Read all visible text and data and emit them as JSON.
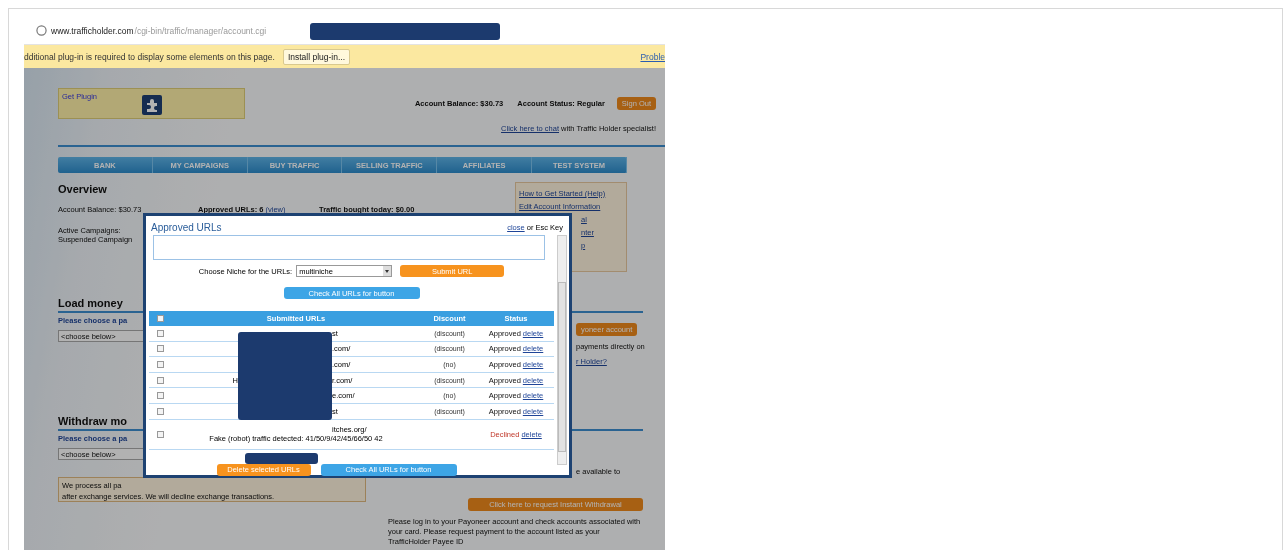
{
  "browser": {
    "url_host": "www.trafficholder.com",
    "url_path": "/cgi-bin/traffic/manager/account.cgi"
  },
  "plugin_bar": {
    "message": "dditional plug-in is required to display some elements on this page.",
    "button": "Install plug-in...",
    "link": "Proble"
  },
  "header": {
    "plugin_label": "Get Plugin",
    "balance": "Account Balance: $30.73",
    "status": "Account Status: Regular",
    "sign_out": "Sign Out",
    "chat_link": "Click here to chat",
    "chat_text": "with Traffic Holder specialist!"
  },
  "nav": [
    {
      "label": "BANK"
    },
    {
      "label": "MY CAMPAIGNS"
    },
    {
      "label": "BUY TRAFFIC"
    },
    {
      "label": "SELLING TRAFFIC"
    },
    {
      "label": "AFFILIATES"
    },
    {
      "label": "TEST SYSTEM"
    }
  ],
  "overview": {
    "title": "Overview",
    "balance": "Account Balance: $30.73",
    "approved_label": "Approved URLs: 6",
    "approved_link": "(view)",
    "traffic": "Traffic bought today: $0.00",
    "campaigns": [
      "Active Campaigns:",
      "Suspended Campaign"
    ],
    "help_links": [
      {
        "text": "How to Get Started (Help)",
        "partial": false
      },
      {
        "text": "Edit Account Information",
        "partial": false
      },
      {
        "text": "al",
        "partial": true
      },
      {
        "text": "nter",
        "partial": true
      },
      {
        "text": "p",
        "partial": true
      }
    ]
  },
  "load_money": {
    "title": "Load money",
    "prompt": "Please choose a pa",
    "select": "<choose below>",
    "button": "yoneer account",
    "note": "payments directly on",
    "link": "r Holder?"
  },
  "withdraw": {
    "title": "Withdraw mo",
    "prompt": "Please choose a pa",
    "select": "<choose below>",
    "notice": [
      "We process all pa",
      "after exchange services. We will decline exchange transactions."
    ],
    "note": "e available to",
    "button": "Click here to request Instant Withdrawal",
    "paragraph": "Please log in to your Payoneer account and check accounts associated with your card. Please request payment to the account listed as your TrafficHolder Payee ID"
  },
  "modal": {
    "title": "Approved URLs",
    "close_link": "close",
    "close_text": "or Esc Key",
    "niche_label": "Choose Niche for the URLs:",
    "niche_value": "multiniche",
    "submit": "Submit URL",
    "check_top": "Check All URLs for button",
    "columns": [
      "Submitted URLs",
      "Discount",
      "Status"
    ],
    "select_all_checked": false,
    "rows": [
      {
        "checked": false,
        "prefix": "",
        "suffix": "st",
        "discount": "(discount)",
        "status": "Approved",
        "kind": "approved",
        "action": "delete"
      },
      {
        "checked": false,
        "prefix": "",
        "suffix": ".com/",
        "discount": "(discount)",
        "status": "Approved",
        "kind": "approved",
        "action": "delete"
      },
      {
        "checked": false,
        "prefix": "",
        "suffix": ".com/",
        "discount": "(no)",
        "status": "Approved",
        "kind": "approved",
        "action": "delete"
      },
      {
        "checked": false,
        "prefix": "H",
        "suffix": "r.com/",
        "discount": "(discount)",
        "status": "Approved",
        "kind": "approved",
        "action": "delete"
      },
      {
        "checked": false,
        "prefix": "",
        "suffix": "e.com/",
        "discount": "(no)",
        "status": "Approved",
        "kind": "approved",
        "action": "delete"
      },
      {
        "checked": false,
        "prefix": "",
        "suffix": "st",
        "discount": "(discount)",
        "status": "Approved",
        "kind": "approved",
        "action": "delete"
      },
      {
        "checked": false,
        "prefix": "",
        "suffix": "itches.org/",
        "note": "Fake (robot) traffic detected: 41/50/9/42/45/66/50 42",
        "discount": "",
        "status": "Declined",
        "kind": "declined",
        "action": "delete"
      }
    ],
    "delete_selected": "Delete selected URLs",
    "check_bottom": "Check All URLs for button"
  }
}
